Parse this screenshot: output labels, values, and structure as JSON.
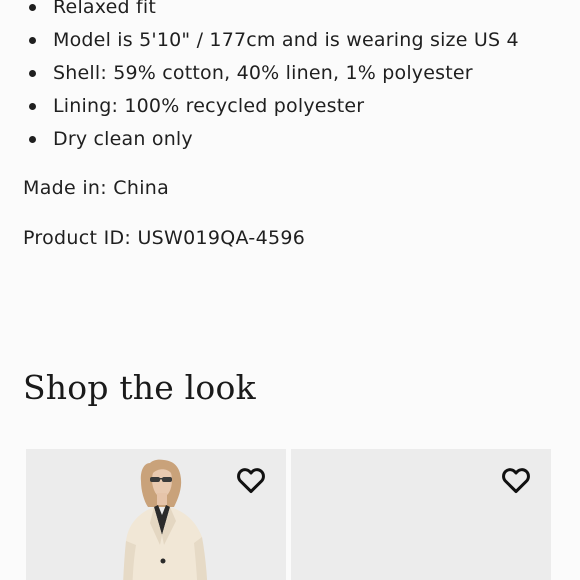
{
  "product_details": {
    "bullets": [
      {
        "text": "Relaxed fit"
      },
      {
        "text": "Model is 5'10\" / 177cm and is wearing size US 4"
      },
      {
        "text": "Shell: 59% cotton, 40% linen, 1% polyester"
      },
      {
        "text": "Lining: 100% recycled polyester"
      },
      {
        "text": "Dry clean only"
      }
    ],
    "made_in": "Made in: China",
    "product_id": "Product ID: USW019QA-4596"
  },
  "shop_the_look": {
    "title": "Shop the look",
    "cards": [
      {
        "wishlist_icon": "heart-outline-icon",
        "image": "model-in-cream-blazer"
      },
      {
        "wishlist_icon": "heart-outline-icon",
        "image": "blank-placeholder"
      }
    ]
  },
  "colors": {
    "background": "#fbfbfb",
    "text": "#1f1f1f",
    "card_background": "#ececec"
  }
}
